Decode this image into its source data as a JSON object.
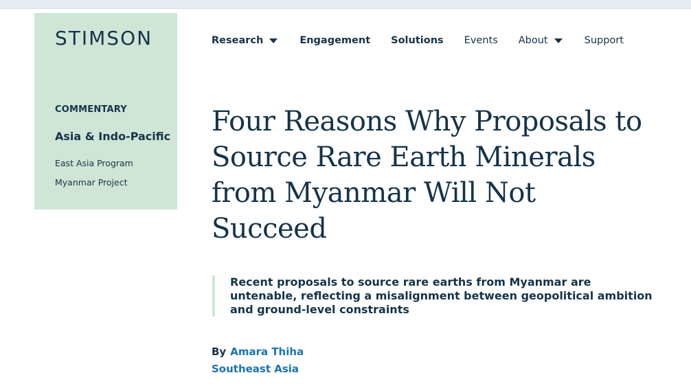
{
  "brand": {
    "logo_text": "STIMSON",
    "color_dark": "#15334a",
    "color_mint": "#cfe6d6",
    "color_link": "#1a74b9"
  },
  "nav": {
    "items": [
      {
        "label": "Research",
        "has_dropdown": true,
        "bold": true
      },
      {
        "label": "Engagement",
        "has_dropdown": false,
        "bold": true
      },
      {
        "label": "Solutions",
        "has_dropdown": false,
        "bold": true
      },
      {
        "label": "Events",
        "has_dropdown": false,
        "bold": false
      },
      {
        "label": "About",
        "has_dropdown": true,
        "bold": false
      },
      {
        "label": "Support",
        "has_dropdown": false,
        "bold": false
      }
    ]
  },
  "sidebar": {
    "category": "COMMENTARY",
    "region": "Asia & Indo-Pacific",
    "programs": [
      "East Asia Program",
      "Myanmar Project"
    ]
  },
  "article": {
    "title": "Four Reasons Why Proposals to Source Rare Earth Minerals from Myanmar Will Not Succeed",
    "summary": "Recent proposals to source rare earths from Myanmar are untenable, reflecting a misalignment between geopolitical ambition and ground-level constraints",
    "byline_prefix": "By",
    "author": "Amara Thiha",
    "department": "Southeast Asia"
  }
}
